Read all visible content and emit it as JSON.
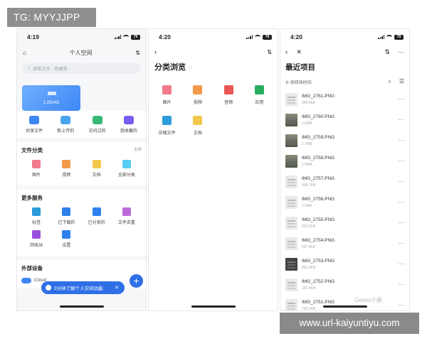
{
  "watermark_top": "TG: MYYJJPP",
  "watermark_bottom": "www.url-kaiyuntiyu.com",
  "screen1": {
    "time": "4:19",
    "battery": "79",
    "title": "个人空间",
    "search_placeholder": "搜索文件、收藏等",
    "card_text": "1.2G/4G",
    "quick": [
      {
        "label": "共享文件",
        "icon": "share-folder-icon",
        "color": "#3e86f5"
      },
      {
        "label": "新上传的",
        "icon": "upload-cloud-icon",
        "color": "#4aa3f0"
      },
      {
        "label": "访问过的",
        "icon": "clock-icon",
        "color": "#39b87a"
      },
      {
        "label": "我收藏的",
        "icon": "star-icon",
        "color": "#7b5cf0"
      }
    ],
    "file_categories": {
      "title": "文件分类",
      "more": "全部",
      "items": [
        {
          "label": "图片",
          "icon": "image-icon",
          "color": "#f27a8a"
        },
        {
          "label": "视频",
          "icon": "video-icon",
          "color": "#f2994a"
        },
        {
          "label": "文档",
          "icon": "document-icon",
          "color": "#f2c94c"
        },
        {
          "label": "全部分类",
          "icon": "grid-icon",
          "color": "#56ccf2"
        }
      ]
    },
    "more_services": {
      "title": "更多服务",
      "items": [
        {
          "label": "标签",
          "icon": "tag-icon",
          "color": "#2d9cdb"
        },
        {
          "label": "已下载的",
          "icon": "download-icon",
          "color": "#2f80ed"
        },
        {
          "label": "已分享的",
          "icon": "share-icon",
          "color": "#2f80ed"
        },
        {
          "label": "文件去重",
          "icon": "dedupe-icon",
          "color": "#bb6bd9"
        },
        {
          "label": "回收站",
          "icon": "trash-icon",
          "color": "#9b51e0"
        },
        {
          "label": "设置",
          "icon": "settings-icon",
          "color": "#2f80ed"
        }
      ]
    },
    "external": {
      "title": "外部设备",
      "cloud_label": "iCloud"
    },
    "toast": "3分钟了解个人空间功能",
    "fab": "+"
  },
  "screen2": {
    "time": "4:20",
    "battery": "79",
    "title": "分类浏览",
    "items": [
      {
        "label": "图片",
        "icon": "image-icon",
        "color": "#f27a8a"
      },
      {
        "label": "视频",
        "icon": "video-icon",
        "color": "#f2994a"
      },
      {
        "label": "音频",
        "icon": "music-icon",
        "color": "#eb5757"
      },
      {
        "label": "应用",
        "icon": "app-cube-icon",
        "color": "#27ae60"
      },
      {
        "label": "压缩文件",
        "icon": "zip-icon",
        "color": "#2d9cdb"
      },
      {
        "label": "文档",
        "icon": "document-icon",
        "color": "#f2c94c"
      }
    ]
  },
  "screen3": {
    "time": "4:20",
    "battery": "79",
    "title": "最近项目",
    "sort_label": "按修改时间",
    "watermark": "Geeks小屋",
    "files": [
      {
        "name": "IMG_2761.PNG",
        "size": "349.6KB",
        "thumb": "light"
      },
      {
        "name": "IMG_2760.PNG",
        "size": "2.6MB",
        "thumb": "photo"
      },
      {
        "name": "IMG_2759.PNG",
        "size": "2.7MB",
        "thumb": "photo"
      },
      {
        "name": "IMG_2758.PNG",
        "size": "1.8MB",
        "thumb": "photo"
      },
      {
        "name": "IMG_2757.PNG",
        "size": "308.7KB",
        "thumb": "light"
      },
      {
        "name": "IMG_2756.PNG",
        "size": "1.4MB",
        "thumb": "light"
      },
      {
        "name": "IMG_2755.PNG",
        "size": "310.2KB",
        "thumb": "light"
      },
      {
        "name": "IMG_2754.PNG",
        "size": "507.9KB",
        "thumb": "light"
      },
      {
        "name": "IMG_2753.PNG",
        "size": "861.8KB",
        "thumb": "dark"
      },
      {
        "name": "IMG_2752.PNG",
        "size": "152.4KB",
        "thumb": "light"
      },
      {
        "name": "IMG_2751.PNG",
        "size": "799.2KB",
        "thumb": "light"
      }
    ]
  }
}
